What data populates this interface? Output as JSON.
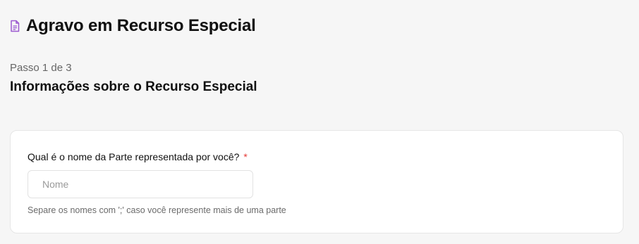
{
  "header": {
    "icon": "document-icon",
    "title": "Agravo em Recurso Especial",
    "accent_color": "#9b59d0"
  },
  "step": {
    "label": "Passo 1 de 3",
    "section_title": "Informações sobre o Recurso Especial"
  },
  "form": {
    "question": "Qual é o nome da Parte representada por você?",
    "required_mark": "*",
    "name_input": {
      "value": "",
      "placeholder": "Nome"
    },
    "hint": "Separe os nomes com ';' caso você represente mais de uma parte"
  }
}
